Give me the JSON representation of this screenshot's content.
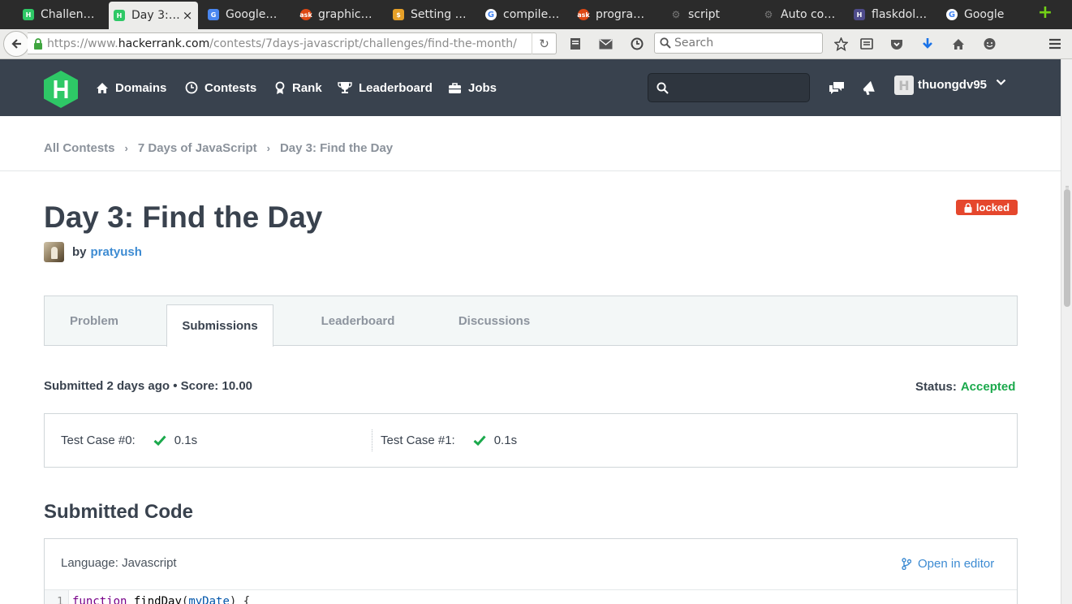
{
  "browser": {
    "tabs": [
      {
        "title": "Challeng…",
        "favicon": "hackerrank",
        "color": "#2ec866",
        "active": false
      },
      {
        "title": "Day 3:…",
        "favicon": "hackerrank",
        "color": "#2ec866",
        "active": true
      },
      {
        "title": "Google …",
        "favicon": "google-translate",
        "color": "#4a87f0",
        "active": false
      },
      {
        "title": "graphics…",
        "favicon": "askubuntu",
        "color": "#dd4814",
        "active": false
      },
      {
        "title": "Setting u…",
        "favicon": "bitcoin",
        "color": "#e6a028",
        "active": false
      },
      {
        "title": "compile …",
        "favicon": "google",
        "color": "#4285f4",
        "active": false
      },
      {
        "title": "program…",
        "favicon": "askubuntu",
        "color": "#dd4814",
        "active": false
      },
      {
        "title": "script",
        "favicon": "github",
        "color": "#555555",
        "active": false
      },
      {
        "title": "Auto co…",
        "favicon": "github",
        "color": "#555555",
        "active": false
      },
      {
        "title": "flaskdoll…",
        "favicon": "heroku",
        "color": "#4e4b8a",
        "active": false
      },
      {
        "title": "Google",
        "favicon": "google",
        "color": "#4285f4",
        "active": false
      }
    ],
    "close_glyph": "×",
    "new_tab_glyph": "+",
    "url_prefix": "https://www.",
    "url_domain": "hackerrank.com",
    "url_path": "/contests/7days-javascript/challenges/find-the-month/",
    "search_placeholder": "Search"
  },
  "header": {
    "nav": [
      {
        "label": "Domains",
        "icon": "home-icon"
      },
      {
        "label": "Contests",
        "icon": "clock-icon"
      },
      {
        "label": "Rank",
        "icon": "rank-icon"
      },
      {
        "label": "Leaderboard",
        "icon": "trophy-icon"
      },
      {
        "label": "Jobs",
        "icon": "briefcase-icon"
      }
    ],
    "username": "thuongdv95",
    "brand_color": "#2ec866",
    "bg_color": "#39424e"
  },
  "breadcrumb": [
    "All Contests",
    "7 Days of JavaScript",
    "Day 3: Find the Day"
  ],
  "breadcrumb_sep": "›",
  "challenge": {
    "title": "Day 3: Find the Day",
    "locked_label": "locked",
    "by_label": "by",
    "author": "pratyush"
  },
  "tabs": [
    {
      "label": "Problem",
      "active": false
    },
    {
      "label": "Submissions",
      "active": true
    },
    {
      "label": "Leaderboard",
      "active": false
    },
    {
      "label": "Discussions",
      "active": false
    }
  ],
  "submission": {
    "summary": "Submitted 2 days ago • Score: 10.00",
    "status_label": "Status:",
    "status_value": "Accepted",
    "status_color": "#1ba94c",
    "test_cases": [
      {
        "label": "Test Case #0:",
        "time": "0.1s"
      },
      {
        "label": "Test Case #1:",
        "time": "0.1s"
      }
    ]
  },
  "code": {
    "heading": "Submitted Code",
    "language": "Language: Javascript",
    "open_in_editor": "Open in editor",
    "line_number": "1",
    "line_keyword": "function",
    "line_name": "findDay",
    "line_param": "myDate",
    "line_open": "(",
    "line_close": ") {"
  }
}
